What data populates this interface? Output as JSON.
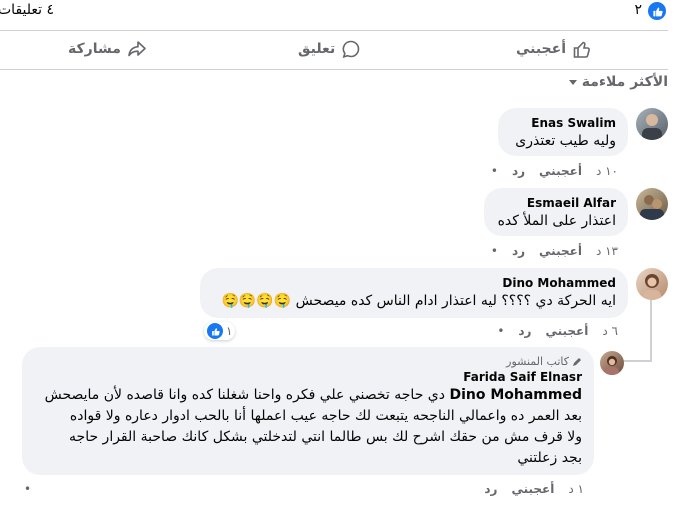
{
  "stats": {
    "like_count": "٢",
    "comments_count": "٤ تعليقات"
  },
  "actions": {
    "like": "أعجبني",
    "comment": "تعليق",
    "share": "مشاركة"
  },
  "sort": {
    "label": "الأكثر ملاءمة"
  },
  "comments": [
    {
      "author": "Enas Swalim",
      "text": "وليه طيب تعتذرى",
      "time": "١٠ د",
      "like": "أعجبني",
      "reply": "رد",
      "extra": "•"
    },
    {
      "author": "Esmaeil Alfar",
      "text": "اعتذار على الملأ كده",
      "time": "١٣ د",
      "like": "أعجبني",
      "reply": "رد",
      "extra": "•"
    },
    {
      "author": "Dino Mohammed",
      "text": "ايه الحركة دي ؟؟؟؟ ليه اعتذار ادام الناس كده ميصحش 🤤🤤🤤🤤",
      "time": "٦ د",
      "like": "أعجبني",
      "reply": "رد",
      "extra": "•",
      "reactions": "١"
    },
    {
      "author": "Farida Saif Elnasr",
      "badge": "كاتب المنشور",
      "text_name": "Dino Mohammed",
      "text": "دي حاجه تخصني علي فكره واحنا شغلنا كده وانا قاصده لأن مايصحش",
      "text2": "بعد العمر ده واعمالي الناجحه يتبعت لك حاجه عيب اعملها أنا بالحب ادوار دعاره ولا قواده",
      "text3": "ولا قرف مش من حقك اشرح لك بس طالما انتي لتدخلتي بشكل كانك صاحبة القرار حاجه",
      "text4": "بجد زعلتني",
      "time": "١ د",
      "like": "أعجبني",
      "reply": "رد",
      "extra": "•"
    }
  ],
  "colors": {
    "accent": "#1877f2",
    "bubble": "#f0f2f5",
    "muted": "#65676b"
  }
}
